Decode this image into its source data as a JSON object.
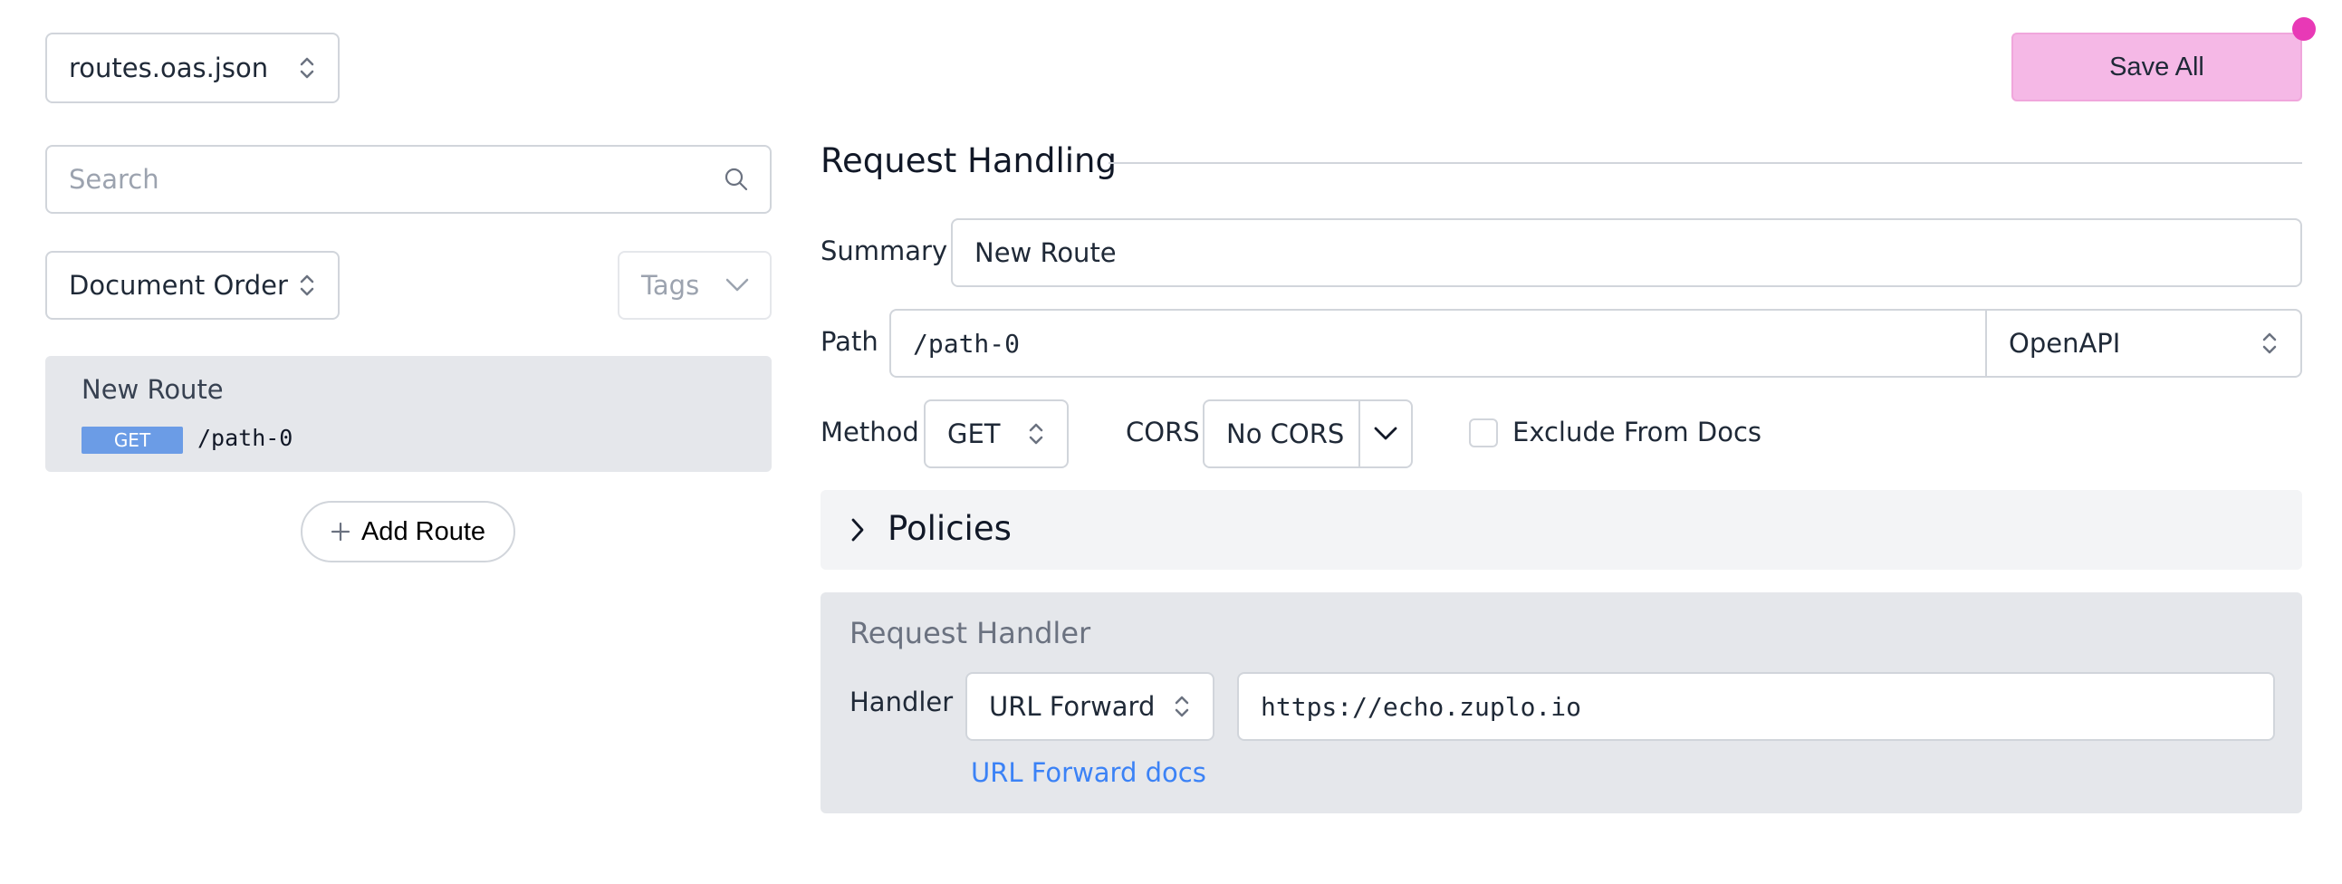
{
  "header": {
    "file_select": "routes.oas.json",
    "save_all_label": "Save All"
  },
  "sidebar": {
    "search_placeholder": "Search",
    "order_select": "Document Order",
    "tags_placeholder": "Tags",
    "routes": [
      {
        "title": "New Route",
        "method": "GET",
        "path": "/path-0"
      }
    ],
    "add_route_label": "Add Route"
  },
  "request_handling": {
    "section_title": "Request Handling",
    "summary_label": "Summary",
    "summary_value": "New Route",
    "path_label": "Path",
    "path_value": "/path-0",
    "path_type": "OpenAPI",
    "method_label": "Method",
    "method_value": "GET",
    "cors_label": "CORS",
    "cors_value": "No CORS",
    "exclude_label": "Exclude From Docs",
    "exclude_checked": false,
    "policies_label": "Policies"
  },
  "request_handler": {
    "title": "Request Handler",
    "handler_label": "Handler",
    "handler_value": "URL Forward",
    "url_value": "https://echo.zuplo.io",
    "docs_link": "URL Forward docs"
  },
  "colors": {
    "save_button": "#f5b8e6",
    "notification_dot": "#e839b6",
    "method_badge": "#6b9ce6",
    "link": "#3b82f6"
  }
}
